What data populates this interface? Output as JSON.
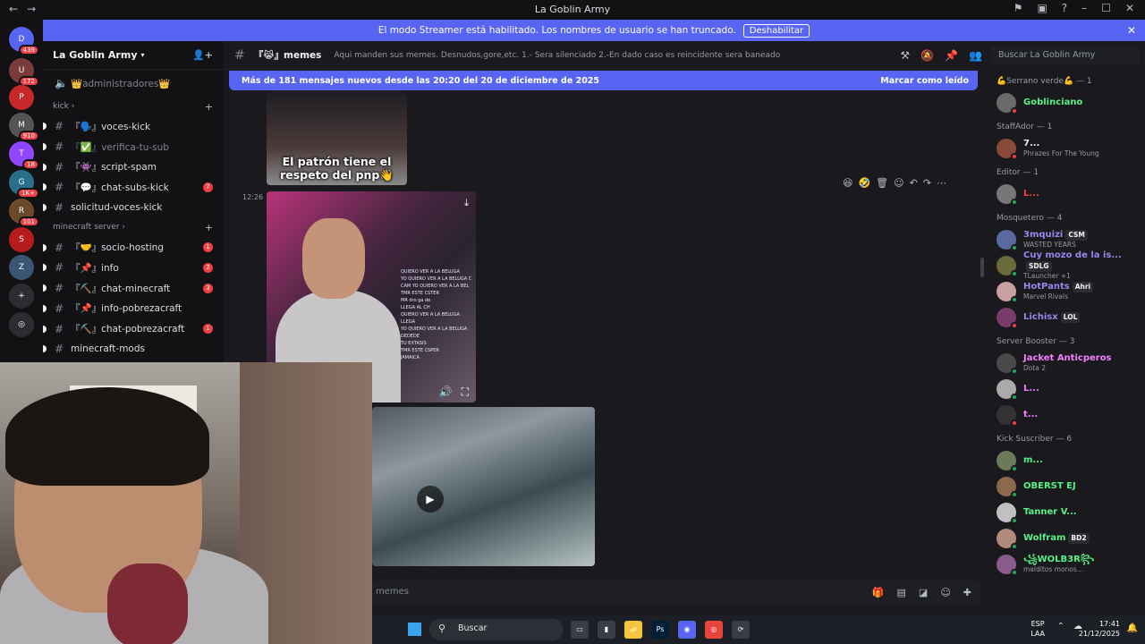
{
  "window": {
    "title": "La Goblin Army",
    "nav_back": "←",
    "nav_forward": "→"
  },
  "banner": {
    "text": "El modo Streamer está habilitado. Los nombres de usuario se han truncado.",
    "button": "Deshabilitar",
    "close": "✕"
  },
  "servers": [
    {
      "label": "D",
      "badge": "439",
      "color": "#5865f2"
    },
    {
      "label": "U",
      "badge": "172",
      "color": "#7b3b3b"
    },
    {
      "label": "P",
      "badge": "",
      "color": "#c62828"
    },
    {
      "label": "M",
      "badge": "910",
      "color": "#555"
    },
    {
      "label": "T",
      "badge": "18",
      "color": "#9146ff"
    },
    {
      "label": "G",
      "badge": "1K+",
      "color": "#2a6f8a"
    },
    {
      "label": "R",
      "badge": "101",
      "color": "#6b4a2a"
    },
    {
      "label": "S",
      "badge": "",
      "color": "#b71c1c"
    },
    {
      "label": "Z",
      "badge": "",
      "color": "#3b5575"
    },
    {
      "label": "+",
      "badge": "",
      "color": "#2b2d31"
    },
    {
      "label": "◎",
      "badge": "",
      "color": "#2b2d31"
    }
  ],
  "sidebar": {
    "server_name": "La Goblin Army",
    "top_channel": "👑administradores👑",
    "categories": [
      {
        "name": "kick",
        "channels": [
          {
            "label": "『🗣️』voces-kick",
            "count": "",
            "muted": false
          },
          {
            "label": "『✅』verifica-tu-sub",
            "count": "",
            "muted": true
          },
          {
            "label": "『👾』script-spam",
            "count": "",
            "muted": false
          },
          {
            "label": "『💬』chat-subs-kick",
            "count": "7",
            "muted": false
          },
          {
            "label": "solicitud-voces-kick",
            "count": "",
            "muted": false
          }
        ]
      },
      {
        "name": "minecraft server",
        "channels": [
          {
            "label": "『🤝』socio-hosting",
            "count": "1",
            "muted": false
          },
          {
            "label": "『📌』info",
            "count": "2",
            "muted": false
          },
          {
            "label": "『⛏️』chat-minecraft",
            "count": "3",
            "muted": false
          },
          {
            "label": "『📌』info-pobrezacraft",
            "count": "",
            "muted": false
          },
          {
            "label": "『⛏️』chat-pobrezacraft",
            "count": "1",
            "muted": false
          },
          {
            "label": "minecraft-mods",
            "count": "",
            "muted": false
          }
        ]
      }
    ]
  },
  "channel": {
    "name": "『😹』memes",
    "topic": "Aqui manden sus memes. Desnudos,gore,etc. 1.- Sera silenciado 2.-En dado caso es reincidente sera baneado",
    "search_placeholder": "Buscar La Goblin Army"
  },
  "new_messages": {
    "text": "Más de 181 mensajes nuevos desde las 20:20 del 20 de diciembre de 2025",
    "action": "Marcar como leído"
  },
  "messages": {
    "meme_caption": "El patrón tiene el respeto del pnp👋",
    "timestamp": "12:26",
    "video_chat_lines": [
      "QUIERO VER A LA BELUGA",
      "YO QUIERO VER A LA BELUGA C",
      "CAM YO QUIERO VER A LA BEL",
      "TMR ESTE CSTER",
      "MR dro ga de",
      "LLEGA AL CH",
      "QUIERO VER A LA BELUGA LLEGA",
      "YO QUIERO VER A LA BELUGA",
      "DEDEDE",
      "TU EXTASIS",
      "TMR ESTE CSPER",
      "JAMAICA"
    ]
  },
  "composer": {
    "placeholder": "memes"
  },
  "members": {
    "groups": [
      {
        "title": "💪Serrano verde💪 — 1",
        "items": [
          {
            "name": "Goblinciano",
            "sub": "",
            "color": "#57f287",
            "status": "#f23f43",
            "av": "#6a6a6a",
            "tag": ""
          }
        ]
      },
      {
        "title": "StaffAdor — 1",
        "items": [
          {
            "name": "7...",
            "sub": "Phrazes For The Young",
            "color": "#f2f3f5",
            "status": "#f23f43",
            "av": "#8a4a3a",
            "tag": ""
          }
        ]
      },
      {
        "title": "Editor — 1",
        "items": [
          {
            "name": "L...",
            "sub": "",
            "color": "#f23f43",
            "status": "#23a55a",
            "av": "#777",
            "tag": ""
          }
        ]
      },
      {
        "title": "Mosquetero — 4",
        "items": [
          {
            "name": "3mquizi",
            "sub": "WASTED YEARS",
            "color": "#9b84ec",
            "status": "#23a55a",
            "av": "#5a6aa0",
            "tag": "CSM"
          },
          {
            "name": "Cuy mozo de la is...",
            "sub": "TLauncher +1",
            "color": "#9b84ec",
            "status": "#23a55a",
            "av": "#6a6a3a",
            "tag": "SDLG"
          },
          {
            "name": "HotPants",
            "sub": "Marvel Rivals",
            "color": "#9b84ec",
            "status": "#23a55a",
            "av": "#c8a0a0",
            "tag": "Ahri"
          },
          {
            "name": "Lichisx",
            "sub": "",
            "color": "#9b84ec",
            "status": "#f23f43",
            "av": "#7a3a6a",
            "tag": "LOL"
          }
        ]
      },
      {
        "title": "Server Booster — 3",
        "items": [
          {
            "name": "Jacket Anticperos",
            "sub": "Dota 2",
            "color": "#f47fff",
            "status": "#23a55a",
            "av": "#4a4a4a",
            "tag": ""
          },
          {
            "name": "L...",
            "sub": "",
            "color": "#f47fff",
            "status": "#23a55a",
            "av": "#aaa",
            "tag": ""
          },
          {
            "name": "t...",
            "sub": "",
            "color": "#f47fff",
            "status": "#f23f43",
            "av": "#333",
            "tag": ""
          }
        ]
      },
      {
        "title": "Kick Suscriber — 6",
        "items": [
          {
            "name": "m...",
            "sub": "",
            "color": "#57f287",
            "status": "#23a55a",
            "av": "#6a7a5a",
            "tag": ""
          },
          {
            "name": "OBERST EJ",
            "sub": "",
            "color": "#57f287",
            "status": "#23a55a",
            "av": "#8a6a4a",
            "tag": ""
          },
          {
            "name": "Tanner V...",
            "sub": "",
            "color": "#57f287",
            "status": "#23a55a",
            "av": "#c0c0c0",
            "tag": ""
          },
          {
            "name": "Wolfram",
            "sub": "",
            "color": "#57f287",
            "status": "#23a55a",
            "av": "#b08a7a",
            "tag": "BD2"
          },
          {
            "name": "꧁WOLB3R꧂",
            "sub": "malditos monos...",
            "color": "#57f287",
            "status": "#23a55a",
            "av": "#8a5a8a",
            "tag": ""
          }
        ]
      }
    ]
  },
  "taskbar": {
    "search": "Buscar",
    "lang_1": "ESP",
    "lang_2": "LAA",
    "time": "17:41",
    "date": "21/12/2025",
    "apps": [
      {
        "label": "▭",
        "color": "#3a3d45"
      },
      {
        "label": "▮",
        "color": "#3a3d45"
      },
      {
        "label": "📁",
        "color": "#f5c542"
      },
      {
        "label": "Ps",
        "color": "#001e36"
      },
      {
        "label": "◉",
        "color": "#5865f2"
      },
      {
        "label": "◎",
        "color": "#e8453c"
      },
      {
        "label": "⟳",
        "color": "#3a3d45"
      }
    ]
  }
}
